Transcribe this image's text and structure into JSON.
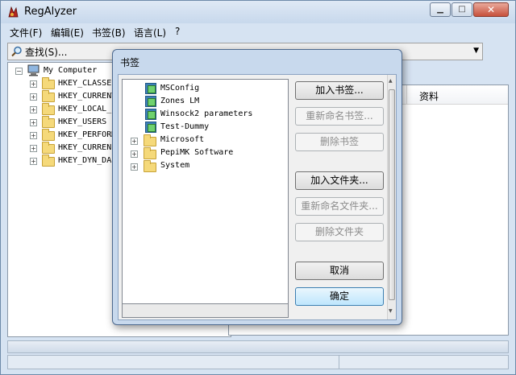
{
  "window": {
    "title": "RegAlyzer",
    "min_glyph": "▁",
    "max_glyph": "□",
    "close_glyph": "✕"
  },
  "menu": {
    "items": [
      "文件(F)",
      "编辑(E)",
      "书签(B)",
      "语言(L)",
      "?"
    ]
  },
  "toolbar": {
    "search_label": "查找(S)...",
    "dropdown_glyph": "▼"
  },
  "tree": {
    "root": "My Computer",
    "items": [
      "HKEY_CLASSES",
      "HKEY_CURRENT",
      "HKEY_LOCAL_",
      "HKEY_USERS",
      "HKEY_PERFORM",
      "HKEY_CURREN",
      "HKEY_DYN_DA"
    ],
    "expander_collapsed": "+",
    "expander_expanded": "−"
  },
  "right_pane": {
    "column_data": "资料"
  },
  "dialog": {
    "title": "书签",
    "bookmarks": [
      "MSConfig",
      "Zones LM",
      "Winsock2 parameters",
      "Test-Dummy"
    ],
    "folders": [
      "Microsoft",
      "PepiMK Software",
      "System"
    ],
    "buttons": {
      "add_bookmark": "加入书签...",
      "rename_bookmark": "重新命名书签...",
      "delete_bookmark": "删除书签",
      "add_folder": "加入文件夹...",
      "rename_folder": "重新命名文件夹...",
      "delete_folder": "删除文件夹",
      "cancel": "取消",
      "ok": "确定"
    }
  },
  "colors": {
    "accent": "#3c7fb1",
    "folder": "#f5d97a",
    "close": "#c7503b"
  }
}
